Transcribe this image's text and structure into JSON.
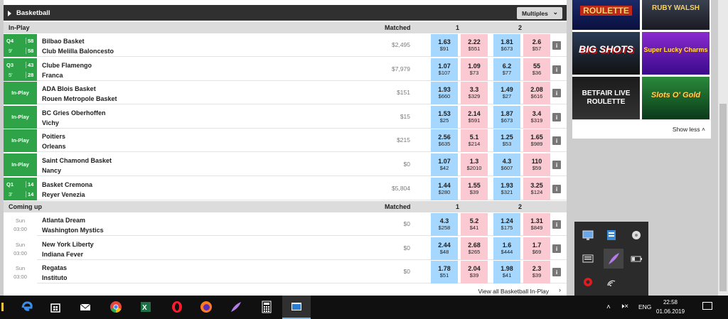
{
  "header": {
    "title": "Basketball",
    "multiples": "Multiples"
  },
  "inplay": {
    "label": "In-Play",
    "matched": "Matched",
    "col1": "1",
    "col2": "2"
  },
  "comingup": {
    "label": "Coming up",
    "matched": "Matched",
    "col1": "1",
    "col2": "2"
  },
  "live_rows": [
    {
      "status": {
        "quarter": "Q4",
        "time": "9'",
        "score1": "58",
        "score2": "58"
      },
      "team1": "Bilbao Basket",
      "team2": "Club Melilla Baloncesto",
      "matched": "$2,495",
      "odds": [
        [
          "1.63",
          "$91"
        ],
        [
          "2.22",
          "$551"
        ],
        [
          "1.81",
          "$673"
        ],
        [
          "2.6",
          "$57"
        ]
      ]
    },
    {
      "status": {
        "quarter": "Q3",
        "time": "5'",
        "score1": "43",
        "score2": "28"
      },
      "team1": "Clube Flamengo",
      "team2": "Franca",
      "matched": "$7,979",
      "odds": [
        [
          "1.07",
          "$107"
        ],
        [
          "1.09",
          "$73"
        ],
        [
          "6.2",
          "$77"
        ],
        [
          "55",
          "$36"
        ]
      ]
    },
    {
      "status": {
        "label": "In-Play"
      },
      "team1": "ADA Blois Basket",
      "team2": "Rouen Metropole Basket",
      "matched": "$151",
      "odds": [
        [
          "1.93",
          "$660"
        ],
        [
          "3.3",
          "$329"
        ],
        [
          "1.49",
          "$27"
        ],
        [
          "2.08",
          "$616"
        ]
      ]
    },
    {
      "status": {
        "label": "In-Play"
      },
      "team1": "BC Gries Oberhoffen",
      "team2": "Vichy",
      "matched": "$15",
      "odds": [
        [
          "1.53",
          "$25"
        ],
        [
          "2.14",
          "$591"
        ],
        [
          "1.87",
          "$673"
        ],
        [
          "3.4",
          "$319"
        ]
      ]
    },
    {
      "status": {
        "label": "In-Play"
      },
      "team1": "Poitiers",
      "team2": "Orleans",
      "matched": "$215",
      "odds": [
        [
          "2.56",
          "$635"
        ],
        [
          "5.1",
          "$214"
        ],
        [
          "1.25",
          "$53"
        ],
        [
          "1.65",
          "$989"
        ]
      ]
    },
    {
      "status": {
        "label": "In-Play"
      },
      "team1": "Saint Chamond Basket",
      "team2": "Nancy",
      "matched": "$0",
      "odds": [
        [
          "1.07",
          "$42"
        ],
        [
          "1.3",
          "$2010"
        ],
        [
          "4.3",
          "$607"
        ],
        [
          "110",
          "$59"
        ]
      ]
    },
    {
      "status": {
        "quarter": "Q1",
        "time": "3'",
        "score1": "14",
        "score2": "14"
      },
      "team1": "Basket Cremona",
      "team2": "Reyer Venezia",
      "matched": "$5,804",
      "odds": [
        [
          "1.44",
          "$280"
        ],
        [
          "1.55",
          "$39"
        ],
        [
          "1.93",
          "$321"
        ],
        [
          "3.25",
          "$124"
        ]
      ]
    }
  ],
  "upcoming_rows": [
    {
      "day": "Sun",
      "time": "03:00",
      "team1": "Atlanta Dream",
      "team2": "Washington Mystics",
      "matched": "$0",
      "odds": [
        [
          "4.3",
          "$258"
        ],
        [
          "5.2",
          "$41"
        ],
        [
          "1.24",
          "$175"
        ],
        [
          "1.31",
          "$849"
        ]
      ]
    },
    {
      "day": "Sun",
      "time": "03:00",
      "team1": "New York Liberty",
      "team2": "Indiana Fever",
      "matched": "$0",
      "odds": [
        [
          "2.44",
          "$48"
        ],
        [
          "2.68",
          "$265"
        ],
        [
          "1.6",
          "$444"
        ],
        [
          "1.7",
          "$69"
        ]
      ]
    },
    {
      "day": "Sun",
      "time": "03:00",
      "team1": "Regatas",
      "team2": "Instituto",
      "matched": "$0",
      "odds": [
        [
          "1.78",
          "$51"
        ],
        [
          "2.04",
          "$39"
        ],
        [
          "1.98",
          "$41"
        ],
        [
          "2.3",
          "$39"
        ]
      ]
    }
  ],
  "info_label": "i",
  "footer_link": "View all Basketball In-Play",
  "side": {
    "tiles": [
      "ROULETTE",
      "RUBY WALSH",
      "BIG SHOTS",
      "Super Lucky Charms",
      "BETFAIR LIVE ROULETTE",
      "Slots O' Gold"
    ],
    "show_less": "Show less"
  },
  "taskbar": {
    "time": "22:58",
    "date": "01.06.2019",
    "lang": "ENG"
  },
  "colors": {
    "back": "#a6d8ff",
    "lay": "#fac9d1",
    "inplay_green": "#2fa348",
    "header": "#303030"
  }
}
